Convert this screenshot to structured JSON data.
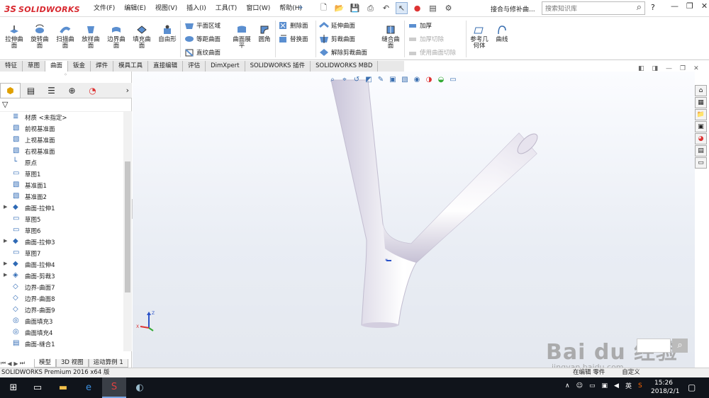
{
  "app": {
    "logo_ds": "3S",
    "logo_text": "SOLIDWORKS",
    "document_title": "接合与修补曲...",
    "search_placeholder": "搜索知识库"
  },
  "menu": [
    "文件(F)",
    "编辑(E)",
    "视图(V)",
    "插入(I)",
    "工具(T)",
    "窗口(W)",
    "帮助(H)"
  ],
  "ribbon": {
    "big_buttons": [
      "拉伸曲面",
      "旋转曲面",
      "扫描曲面",
      "放样曲面",
      "边界曲面",
      "填充曲面",
      "自由形",
      "曲面展平",
      "圆角",
      "缝合曲面",
      "参考几何体",
      "曲线"
    ],
    "small_buttons": {
      "plane_region": "平面区域",
      "offset_surface": "等距曲面",
      "ruled_surface": "直纹曲面",
      "delete_face": "删除面",
      "replace_face": "替换面",
      "extend_surface": "延伸曲面",
      "trim_surface": "剪裁曲面",
      "untrim_surface": "解除剪裁曲面",
      "thicken": "加厚",
      "thicken_cut": "加厚切除",
      "cut_with_surface": "使用曲面切除"
    }
  },
  "command_tabs": [
    "特征",
    "草图",
    "曲面",
    "钣金",
    "焊件",
    "模具工具",
    "直接编辑",
    "评估",
    "DimXpert",
    "SOLIDWORKS 插件",
    "SOLIDWORKS MBD"
  ],
  "active_command_tab": "曲面",
  "feature_tree": [
    {
      "label": "材质 <未指定>",
      "icon": "material-icon",
      "expandable": false
    },
    {
      "label": "前视基准面",
      "icon": "plane-icon",
      "expandable": false
    },
    {
      "label": "上视基准面",
      "icon": "plane-icon",
      "expandable": false
    },
    {
      "label": "右视基准面",
      "icon": "plane-icon",
      "expandable": false
    },
    {
      "label": "原点",
      "icon": "origin-icon",
      "expandable": false
    },
    {
      "label": "草图1",
      "icon": "sketch-icon",
      "expandable": false
    },
    {
      "label": "基准面1",
      "icon": "plane-icon",
      "expandable": false
    },
    {
      "label": "基准面2",
      "icon": "plane-icon",
      "expandable": false
    },
    {
      "label": "曲面-拉伸1",
      "icon": "surface-extrude-icon",
      "expandable": true
    },
    {
      "label": "草图5",
      "icon": "sketch-icon",
      "expandable": false
    },
    {
      "label": "草图6",
      "icon": "sketch-icon",
      "expandable": false
    },
    {
      "label": "曲面-拉伸3",
      "icon": "surface-extrude-icon",
      "expandable": true
    },
    {
      "label": "草图7",
      "icon": "sketch-icon",
      "expandable": false
    },
    {
      "label": "曲面-拉伸4",
      "icon": "surface-extrude-icon",
      "expandable": true
    },
    {
      "label": "曲面-剪裁3",
      "icon": "surface-trim-icon",
      "expandable": true
    },
    {
      "label": "边界-曲面7",
      "icon": "boundary-surface-icon",
      "expandable": false
    },
    {
      "label": "边界-曲面8",
      "icon": "boundary-surface-icon",
      "expandable": false
    },
    {
      "label": "边界-曲面9",
      "icon": "boundary-surface-icon",
      "expandable": false
    },
    {
      "label": "曲面填充3",
      "icon": "fill-surface-icon",
      "expandable": false
    },
    {
      "label": "曲面填充4",
      "icon": "fill-surface-icon",
      "expandable": false
    },
    {
      "label": "曲面-缝合1",
      "icon": "knit-surface-icon",
      "expandable": false
    }
  ],
  "model_tabs": [
    "模型",
    "3D 视图",
    "运动算例 1"
  ],
  "status": {
    "left": "SOLIDWORKS Premium 2016 x64 版",
    "middle": "在编辑 零件",
    "right": "自定义"
  },
  "watermark": {
    "main": "Bai du 经验",
    "sub": "jingyan.baidu.com"
  },
  "taskbar": {
    "ime": "英",
    "time": "15:26",
    "date": "2018/2/1"
  },
  "colors": {
    "brand": "#d8282f",
    "accent": "#3a6fb0",
    "taskbar": "#10141b"
  }
}
